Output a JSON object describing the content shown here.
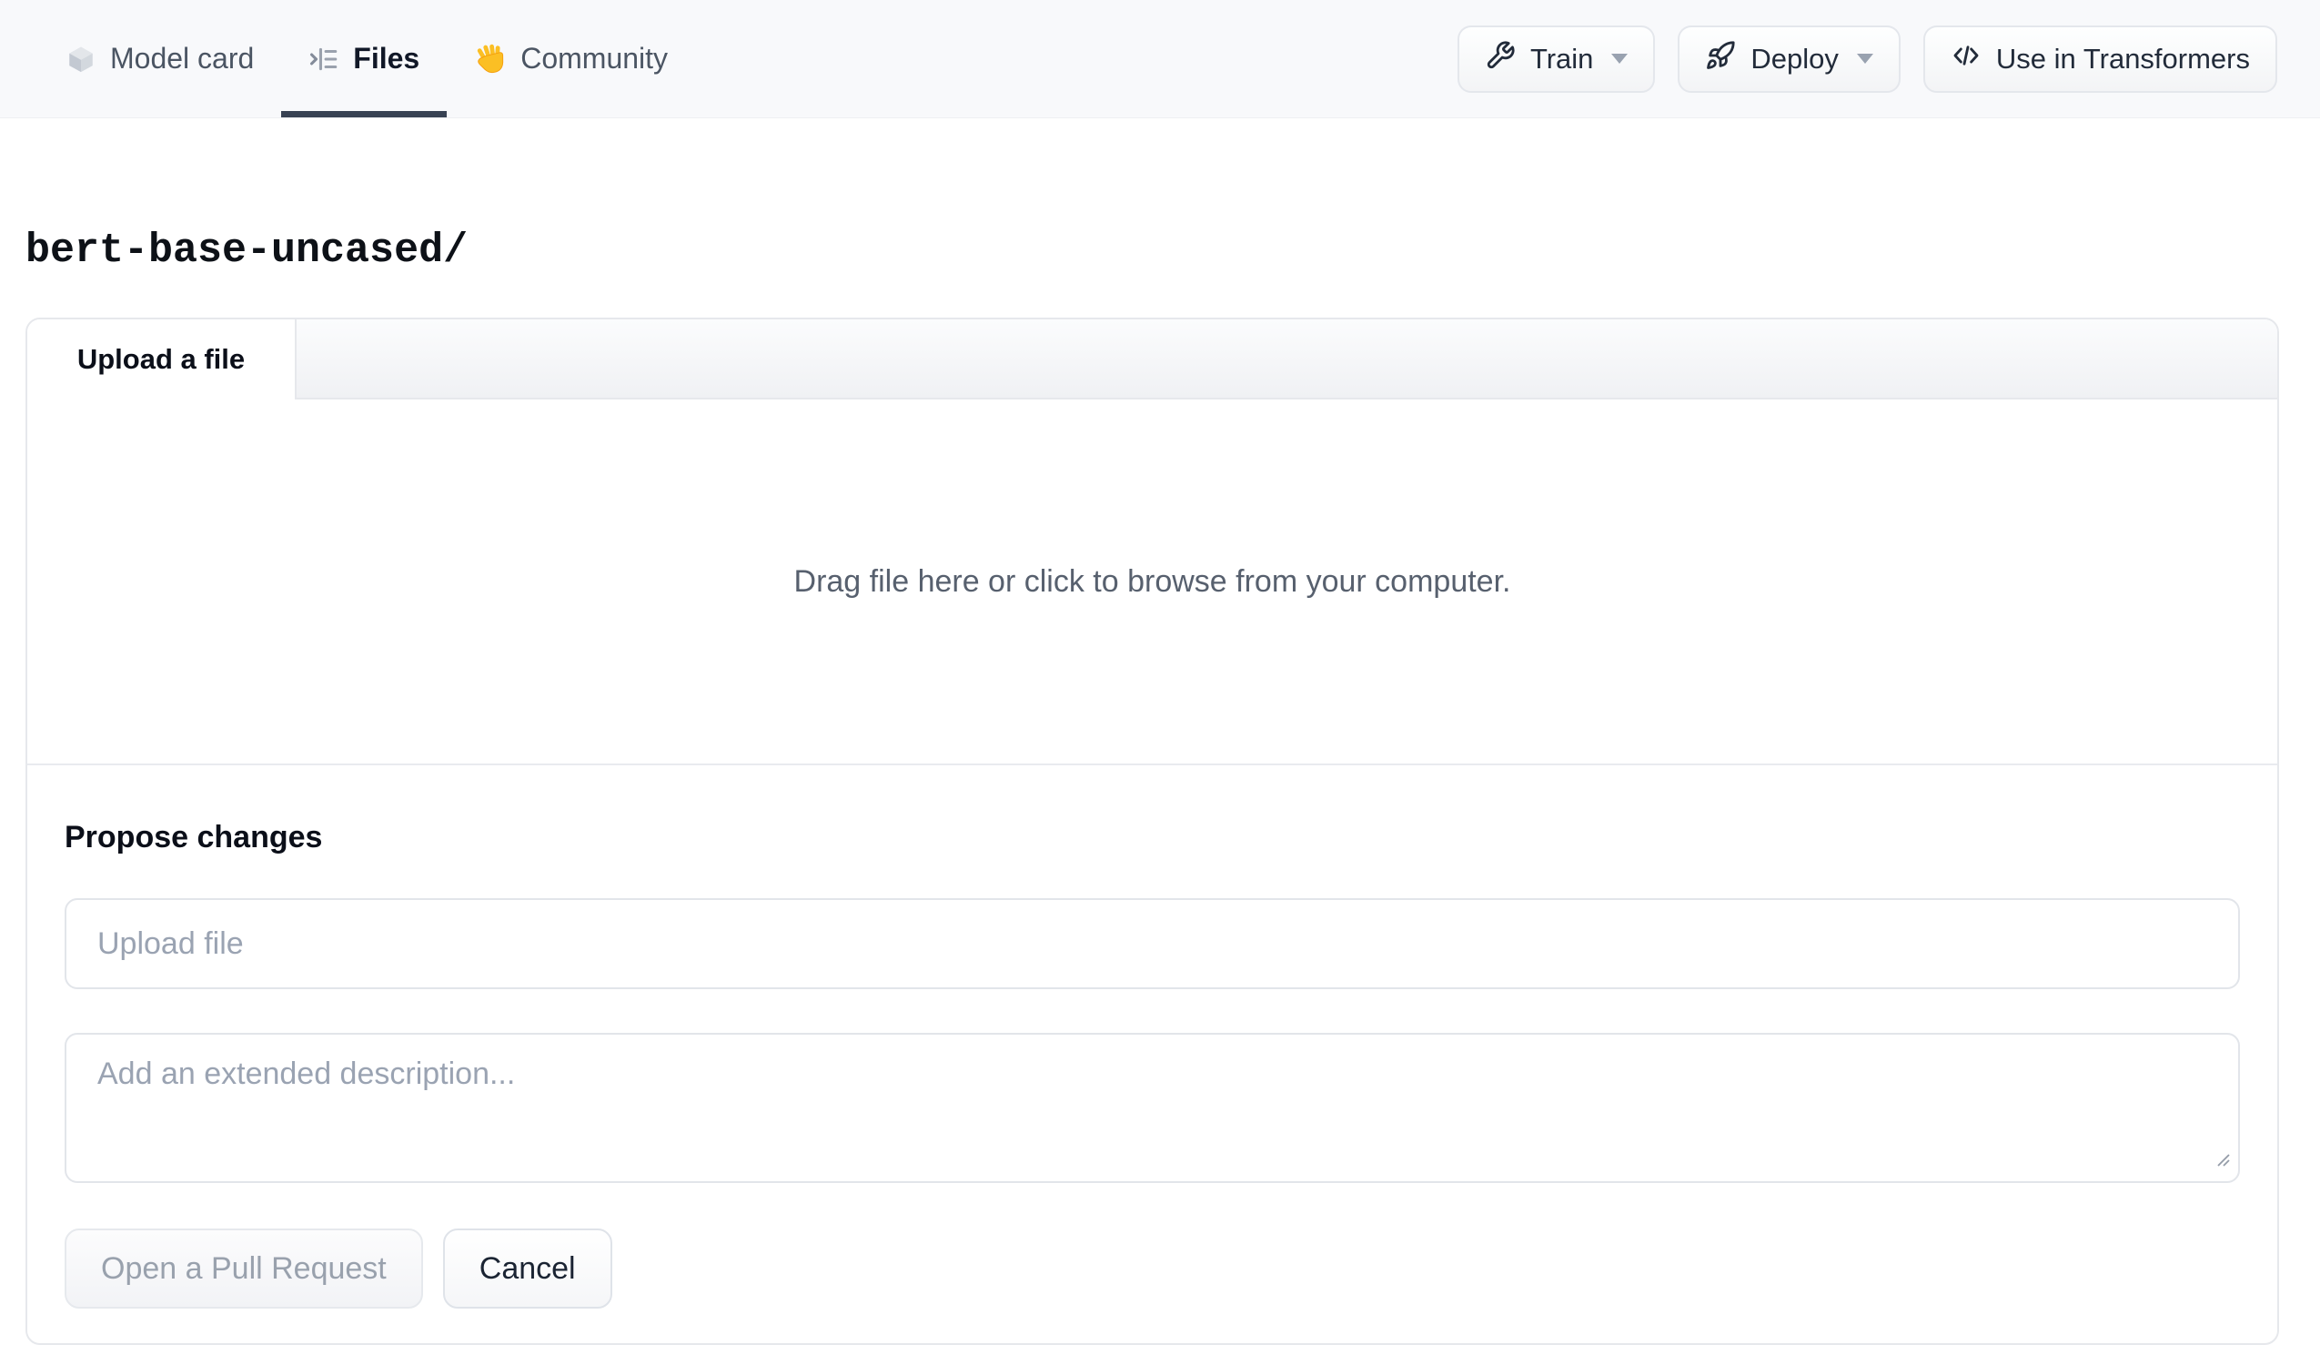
{
  "nav": {
    "tabs": [
      {
        "label": "Model card",
        "icon": "cube-icon",
        "active": false
      },
      {
        "label": "Files",
        "icon": "files-icon",
        "active": true
      },
      {
        "label": "Community",
        "icon": "wave-icon",
        "active": false
      }
    ],
    "actions": [
      {
        "label": "Train",
        "icon": "wrench-icon",
        "has_caret": true
      },
      {
        "label": "Deploy",
        "icon": "rocket-icon",
        "has_caret": true
      },
      {
        "label": "Use in Transformers",
        "icon": "code-icon",
        "has_caret": false
      }
    ]
  },
  "header": {
    "repo_path": "bert-base-uncased/"
  },
  "upload_card": {
    "tab_label": "Upload a file",
    "dropzone_text": "Drag file here or click to browse from your computer.",
    "propose": {
      "heading": "Propose changes",
      "filename_placeholder": "Upload file",
      "description_placeholder": "Add an extended description...",
      "submit_label": "Open a Pull Request",
      "cancel_label": "Cancel"
    }
  },
  "colors": {
    "nav_bg": "#f8f9fb",
    "active_tab_underline": "#384253",
    "nav_text": "#4b5563",
    "active_text": "#111827",
    "border": "#e6e8ec",
    "muted_text": "#57606e",
    "placeholder": "#9aa3b2",
    "disabled_button_text": "#99a1ad",
    "dark_button_text": "#1b2433"
  }
}
